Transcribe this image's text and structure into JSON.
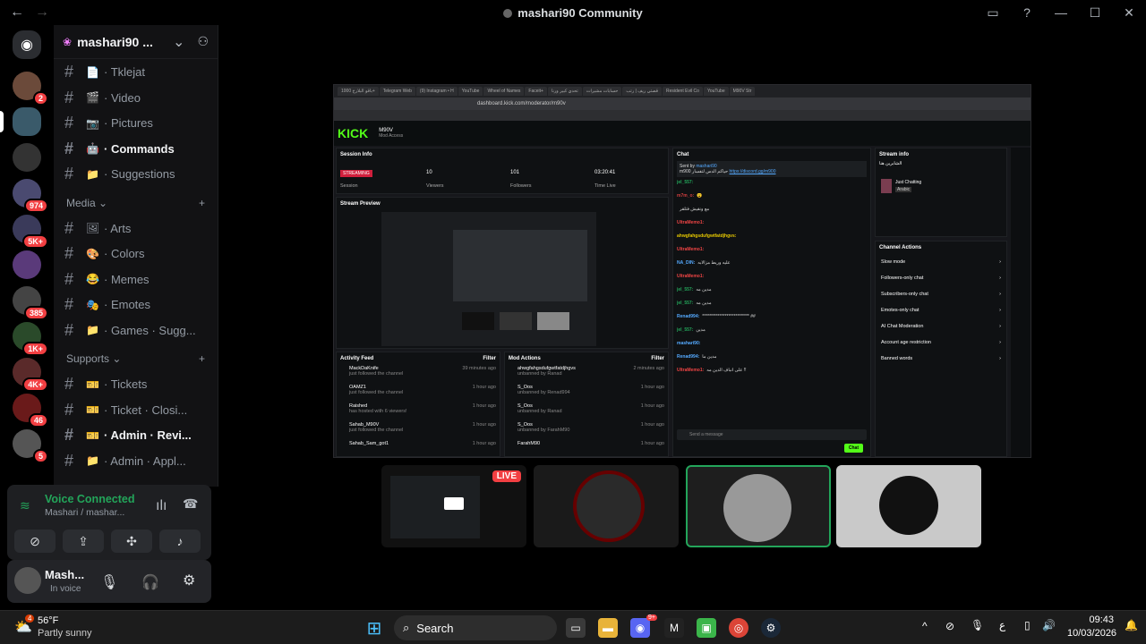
{
  "window": {
    "title": "mashari90 Community",
    "back": "←",
    "forward": "→"
  },
  "server": {
    "name": "mashari90 ...",
    "chevron": "⌄"
  },
  "channels_top": [
    {
      "label": "· Tklejat",
      "emoji": "📄",
      "bold": false
    },
    {
      "label": "· Video",
      "emoji": "🎬",
      "bold": false
    },
    {
      "label": "· Pictures",
      "emoji": "📷",
      "bold": false
    },
    {
      "label": "· Commands",
      "emoji": "🤖",
      "bold": true
    },
    {
      "label": "· Suggestions",
      "emoji": "📁",
      "bold": false
    }
  ],
  "cat_media": "Media",
  "channels_media": [
    {
      "label": "· Arts",
      "emoji": "🖼",
      "bold": false
    },
    {
      "label": "· Colors",
      "emoji": "🎨",
      "bold": false
    },
    {
      "label": "· Memes",
      "emoji": "😂",
      "bold": false
    },
    {
      "label": "· Emotes",
      "emoji": "🎭",
      "bold": false
    },
    {
      "label": "· Games · Sugg...",
      "emoji": "📁",
      "bold": false
    }
  ],
  "cat_supports": "Supports",
  "channels_supports": [
    {
      "label": "· Tickets",
      "emoji": "🎫",
      "bold": false
    },
    {
      "label": "· Ticket · Closi...",
      "emoji": "🎫",
      "bold": false
    },
    {
      "label": "· Admin · Revi...",
      "emoji": "🎫",
      "bold": true
    },
    {
      "label": "· Admin · Appl...",
      "emoji": "📁",
      "bold": false
    }
  ],
  "server_badges": [
    "2",
    "974",
    "5K+",
    "385",
    "1K+",
    "4K+",
    "46",
    "5"
  ],
  "voice": {
    "status": "Voice Connected",
    "channel": "Mashari / mashar..."
  },
  "user": {
    "name": "Mash...",
    "status": "In voice"
  },
  "stream": {
    "tabs": [
      "باقو البلارخ 1000+",
      "Telegram Web",
      "(9) Instagram • H",
      "YouTube",
      "Wheel of Names",
      "Faceit+",
      "تحدي كبير ورنا",
      "حسابات مشيرات",
      "قصتي ريف | رتب",
      "Resident Evil Co",
      "YouTube",
      "M90V Str"
    ],
    "url": "dashboard.kick.com/moderator/m90v",
    "logo": "KICK",
    "channel": "M90V",
    "channel_sub": "Mod Access",
    "session_title": "Session Info",
    "streaming": "STREAMING",
    "session_label": "Session",
    "viewers": "10",
    "viewers_label": "Viewers",
    "followers": "101",
    "followers_label": "Followers",
    "time": "03:20:41",
    "time_label": "Time Live",
    "preview_title": "Stream Preview",
    "activity_title": "Activity Feed",
    "filter": "Filter",
    "activity": [
      {
        "name": "MackDaKnife",
        "sub": "just followed the channel",
        "t": "39 minutes ago"
      },
      {
        "name": "OAMZ1",
        "sub": "just followed the channel",
        "t": "1 hour ago"
      },
      {
        "name": "Raished",
        "sub": "has hosted with 6 viewers!",
        "t": "1 hour ago"
      },
      {
        "name": "Sahab_M90V",
        "sub": "just followed the channel",
        "t": "1 hour ago"
      },
      {
        "name": "Sahab_Sam_got1",
        "sub": "",
        "t": "1 hour ago"
      }
    ],
    "mod_title": "Mod Actions",
    "mod": [
      {
        "name": "ahwgfahgsdufgwtfatdjhgvs",
        "sub": "unbanned by Ranad",
        "t": "2 minutes ago"
      },
      {
        "name": "S_Oos",
        "sub": "unbanned by Renad994",
        "t": "1 hour ago"
      },
      {
        "name": "S_Oos",
        "sub": "unbanned by Ranad",
        "t": "1 hour ago"
      },
      {
        "name": "S_Oos",
        "sub": "unbanned by FarahM90",
        "t": "1 hour ago"
      },
      {
        "name": "FarahM90",
        "sub": "",
        "t": "1 hour ago"
      }
    ],
    "chat_title": "Chat",
    "pinned_by": "Sent by",
    "pinned_user": "mashari90",
    "pinned_msg": "m900 حياكم الدس لتفسار",
    "pinned_link": "https://discord.gg/m900",
    "chat": [
      {
        "u": "jel_557:",
        "m": "",
        "c": "#23a55a"
      },
      {
        "u": "m7m_o:",
        "m": "😮",
        "c": "#d23f3f"
      },
      {
        "u": "",
        "m": "مع ونقيش فتلقر",
        "c": "#aaa"
      },
      {
        "u": "UltraMemo1:",
        "m": "",
        "c": "#e44"
      },
      {
        "u": "ahwgfahgsdufgwtfatdjhgvs:",
        "m": "",
        "c": "#e6c800"
      },
      {
        "u": "UltraMemo1:",
        "m": "",
        "c": "#e44"
      },
      {
        "u": "NA_DIN:",
        "m": "عليه وريط مزالابه",
        "c": "#5af"
      },
      {
        "u": "UltraMemo1:",
        "m": "",
        "c": "#e44"
      },
      {
        "u": "jel_557:",
        "m": "مدين مه",
        "c": "#23a55a"
      },
      {
        "u": "jel_557:",
        "m": "مدين مه",
        "c": "#23a55a"
      },
      {
        "u": "Renad994:",
        "m": "*************************** ##",
        "c": "#5af"
      },
      {
        "u": "jel_557:",
        "m": "مدين",
        "c": "#23a55a"
      },
      {
        "u": "mashari90:",
        "m": "",
        "c": "#5af"
      },
      {
        "u": "Renad994:",
        "m": "مدين ما",
        "c": "#5af"
      },
      {
        "u": "UltraMemo1:",
        "m": "على انباف الدين مه !!",
        "c": "#e44"
      }
    ],
    "send_placeholder": "Send a message",
    "chat_btn": "Chat",
    "info_title": "Stream info",
    "info_game": "Just Chatting",
    "info_lang": "Arabic",
    "info_arabic": "الشابرين هنا",
    "actions_title": "Channel Actions",
    "actions": [
      "Slow mode",
      "Followers-only chat",
      "Subscribers-only chat",
      "Emotes-only chat",
      "AI Chat Moderation",
      "Account age restriction",
      "Banned words"
    ]
  },
  "live_label": "LIVE",
  "taskbar": {
    "temp": "56°F",
    "weather": "Partly sunny",
    "weather_badge": "4",
    "search": "Search",
    "time": "09:43",
    "date": "10/03/2026",
    "lang": "ع",
    "discord_badge": "9+"
  },
  "colors": {
    "accent": "#53fc18",
    "discord_green": "#23a55a",
    "badge_red": "#f23f42"
  }
}
